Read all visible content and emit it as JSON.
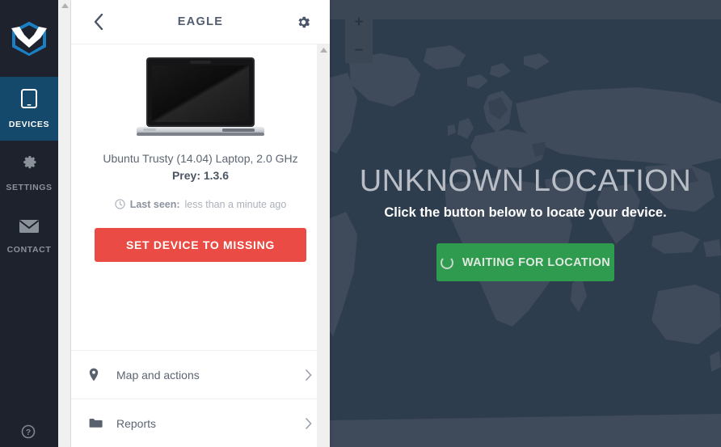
{
  "sidebar": {
    "logo_name": "prey-logo",
    "items": [
      {
        "label": "DEVICES",
        "icon": "device-tablet-icon",
        "active": true
      },
      {
        "label": "SETTINGS",
        "icon": "gear-icon",
        "active": false
      },
      {
        "label": "CONTACT",
        "icon": "envelope-icon",
        "active": false
      }
    ],
    "help_icon": "help-circle-icon",
    "active_bg": "#14496b",
    "bg": "#1d222c"
  },
  "panel": {
    "title": "EAGLE",
    "back_icon": "chevron-left-icon",
    "settings_icon": "gear-icon",
    "device": {
      "image_icon": "laptop-image",
      "name": "Ubuntu Trusty (14.04) Laptop, 2.0 GHz",
      "version": "Prey: 1.3.6",
      "last_seen_icon": "clock-icon",
      "last_seen_label": "Last seen:",
      "last_seen_value": "less than a minute ago"
    },
    "missing_button": {
      "label": "SET DEVICE TO MISSING",
      "color": "#ea4b44"
    },
    "menu": [
      {
        "label": "Map and actions",
        "icon": "map-pin-icon",
        "chevron": "chevron-right-icon"
      },
      {
        "label": "Reports",
        "icon": "folder-icon",
        "chevron": "chevron-right-icon"
      }
    ]
  },
  "map": {
    "zoom_in_label": "+",
    "zoom_out_label": "–",
    "ocean_color": "#2e3d4e",
    "land_color": "#3f4a5a",
    "topbar_color": "#3c4756"
  },
  "location": {
    "title": "UNKNOWN LOCATION",
    "subtitle": "Click the button below to locate your device.",
    "button_label": "WAITING FOR LOCATION",
    "button_icon": "spinner-icon",
    "button_color": "#2e9b4f"
  },
  "scrollbars": {
    "up_arrow_icon": "scroll-up-arrow-icon"
  }
}
